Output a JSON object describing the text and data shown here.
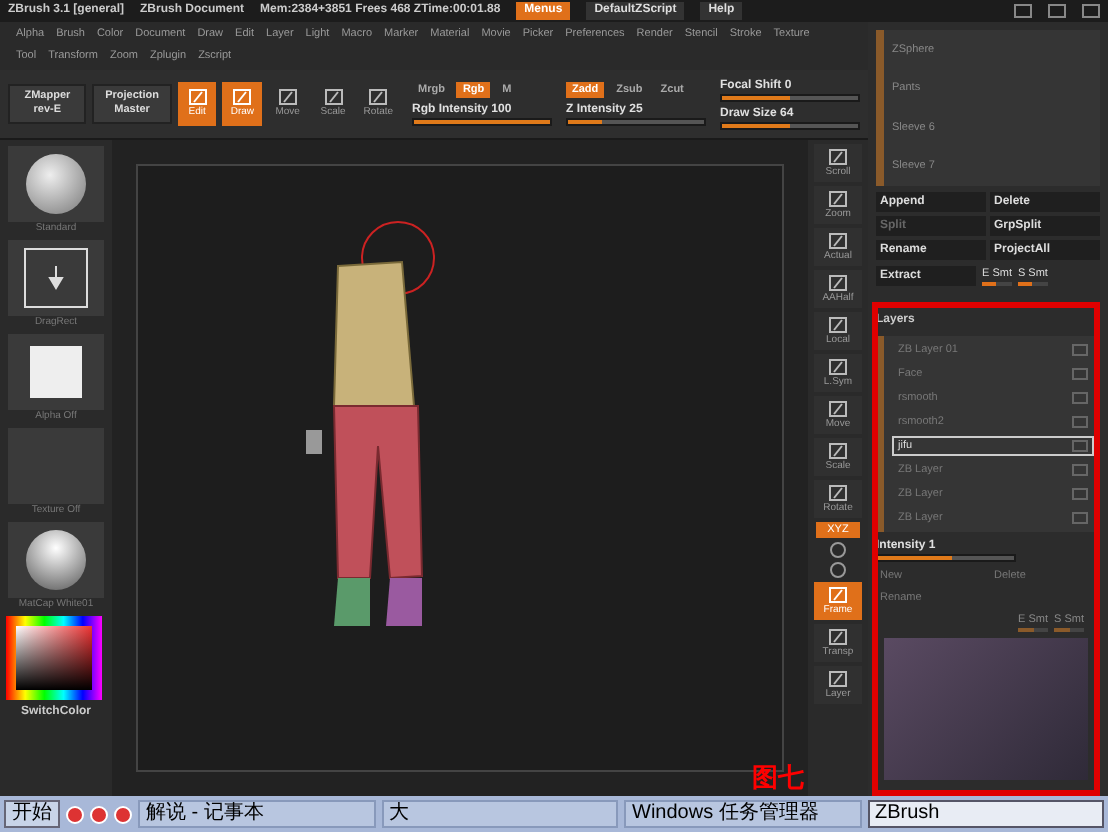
{
  "title_bar": {
    "app": "ZBrush 3.1 [general]",
    "document": "ZBrush Document",
    "stats": "Mem:2384+3851 Frees 468 ZTime:00:01.88",
    "buttons": [
      {
        "label": "Menus",
        "selected": true
      },
      {
        "label": "DefaultZScript",
        "selected": false
      },
      {
        "label": "Help",
        "selected": false
      }
    ]
  },
  "menus": [
    [
      "Alpha",
      "Brush",
      "Color",
      "Document",
      "Draw",
      "Edit",
      "Layer",
      "Light",
      "Macro",
      "Marker",
      "Material",
      "Movie",
      "Picker",
      "Preferences",
      "Render",
      "Stencil",
      "Stroke",
      "Texture"
    ],
    [
      "Tool",
      "Transform",
      "Zoom",
      "Zplugin",
      "Zscript"
    ]
  ],
  "toolbar": {
    "plugins": [
      {
        "lines": [
          "ZMapper",
          "rev-E"
        ]
      },
      {
        "lines": [
          "Projection",
          "Master"
        ]
      }
    ],
    "tools": [
      {
        "label": "Edit",
        "selected": true
      },
      {
        "label": "Draw",
        "selected": true
      },
      {
        "label": "Move",
        "selected": false
      },
      {
        "label": "Scale",
        "selected": false
      },
      {
        "label": "Rotate",
        "selected": false
      }
    ],
    "groups": [
      {
        "switches": [
          {
            "label": "Mrgb",
            "selected": false
          },
          {
            "label": "Rgb",
            "selected": true
          },
          {
            "label": "M",
            "selected": false
          }
        ],
        "slider": {
          "label": "Rgb Intensity 100",
          "level": 1
        }
      },
      {
        "switches": [
          {
            "label": "Zadd",
            "selected": true
          },
          {
            "label": "Zsub",
            "selected": false
          },
          {
            "label": "Zcut",
            "selected": false
          }
        ],
        "slider": {
          "label": "Z Intensity 25",
          "level": 0.25
        }
      }
    ],
    "sliders": [
      {
        "label": "Focal Shift 0",
        "level": 0.5
      },
      {
        "label": "Draw Size 64",
        "level": 0.5
      }
    ]
  },
  "left_panel": {
    "thumbnails": [
      {
        "kind": "brush",
        "label": "Standard"
      },
      {
        "kind": "stroke",
        "label": "DragRect"
      },
      {
        "kind": "alpha",
        "label": "Alpha Off"
      },
      {
        "kind": "texture",
        "label": "Texture Off"
      },
      {
        "kind": "material",
        "label": "MatCap White01"
      }
    ],
    "color_label": "SwitchColor"
  },
  "canvas": {
    "caption": "图七"
  },
  "right_toolbar": [
    {
      "kind": "icon",
      "label": "Scroll",
      "selected": false
    },
    {
      "kind": "icon",
      "label": "Zoom",
      "selected": false
    },
    {
      "kind": "icon",
      "label": "Actual",
      "selected": false
    },
    {
      "kind": "icon",
      "label": "AAHalf",
      "selected": false
    },
    {
      "kind": "icon",
      "label": "Local",
      "selected": false
    },
    {
      "kind": "icon",
      "label": "L.Sym",
      "selected": false
    },
    {
      "kind": "icon",
      "label": "Move",
      "selected": false
    },
    {
      "kind": "icon",
      "label": "Scale",
      "selected": false
    },
    {
      "kind": "icon",
      "label": "Rotate",
      "selected": false
    },
    {
      "kind": "tag",
      "label": "XYZ",
      "selected": true
    },
    {
      "kind": "small"
    },
    {
      "kind": "small"
    },
    {
      "kind": "icon",
      "label": "Frame",
      "selected": true
    },
    {
      "kind": "icon",
      "label": "Transp",
      "selected": false
    },
    {
      "kind": "icon",
      "label": "Layer",
      "selected": false
    }
  ],
  "right_panel": {
    "subtools": [
      {
        "label": "ZSphere"
      },
      {
        "label": "Pants"
      },
      {
        "label": "Sleeve 6"
      },
      {
        "label": "Sleeve 7"
      }
    ],
    "buttons": [
      {
        "label": "Append",
        "disabled": false
      },
      {
        "label": "Delete",
        "disabled": false
      },
      {
        "label": "Split",
        "disabled": true
      },
      {
        "label": "GrpSplit",
        "disabled": false
      },
      {
        "label": "Rename",
        "disabled": false
      },
      {
        "label": "ProjectAll",
        "disabled": false
      }
    ],
    "extract": {
      "label": "Extract",
      "e_smt": {
        "label": "E Smt",
        "level": 0.5
      },
      "s_smt": {
        "label": "S Smt",
        "level": 0.5
      }
    },
    "layers": {
      "title": "Layers",
      "items": [
        {
          "label": "ZB Layer 01",
          "selected": false
        },
        {
          "label": "Face",
          "selected": false
        },
        {
          "label": "rsmooth",
          "selected": false
        },
        {
          "label": "rsmooth2",
          "selected": false
        },
        {
          "label": "jifu",
          "selected": true
        },
        {
          "label": "ZB Layer",
          "selected": false
        },
        {
          "label": "ZB Layer",
          "selected": false
        },
        {
          "label": "ZB Layer",
          "selected": false
        }
      ],
      "intensity": {
        "label": "Intensity 1",
        "level": 0.55
      },
      "buttons": [
        "New",
        "Delete",
        "Rename"
      ],
      "e_smt": {
        "label": "E Smt",
        "level": 0.5
      },
      "s_smt": {
        "label": "S Smt",
        "level": 0.5
      }
    }
  },
  "taskbar": {
    "start": "开始",
    "tasks": [
      {
        "label": "解说 - 记事本",
        "selected": false
      },
      {
        "label": "大",
        "selected": false
      },
      {
        "label": "Windows 任务管理器",
        "selected": false
      },
      {
        "label": "ZBrush",
        "selected": true
      }
    ]
  }
}
